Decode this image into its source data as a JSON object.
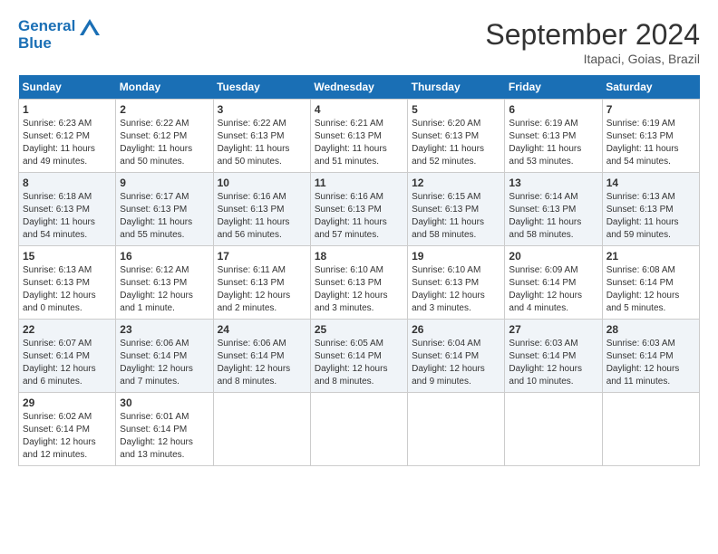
{
  "header": {
    "logo_line1": "General",
    "logo_line2": "Blue",
    "month_title": "September 2024",
    "location": "Itapaci, Goias, Brazil"
  },
  "days_of_week": [
    "Sunday",
    "Monday",
    "Tuesday",
    "Wednesday",
    "Thursday",
    "Friday",
    "Saturday"
  ],
  "weeks": [
    [
      {
        "day": "1",
        "sunrise": "6:23 AM",
        "sunset": "6:12 PM",
        "daylight": "11 hours and 49 minutes."
      },
      {
        "day": "2",
        "sunrise": "6:22 AM",
        "sunset": "6:12 PM",
        "daylight": "11 hours and 50 minutes."
      },
      {
        "day": "3",
        "sunrise": "6:22 AM",
        "sunset": "6:13 PM",
        "daylight": "11 hours and 50 minutes."
      },
      {
        "day": "4",
        "sunrise": "6:21 AM",
        "sunset": "6:13 PM",
        "daylight": "11 hours and 51 minutes."
      },
      {
        "day": "5",
        "sunrise": "6:20 AM",
        "sunset": "6:13 PM",
        "daylight": "11 hours and 52 minutes."
      },
      {
        "day": "6",
        "sunrise": "6:19 AM",
        "sunset": "6:13 PM",
        "daylight": "11 hours and 53 minutes."
      },
      {
        "day": "7",
        "sunrise": "6:19 AM",
        "sunset": "6:13 PM",
        "daylight": "11 hours and 54 minutes."
      }
    ],
    [
      {
        "day": "8",
        "sunrise": "6:18 AM",
        "sunset": "6:13 PM",
        "daylight": "11 hours and 54 minutes."
      },
      {
        "day": "9",
        "sunrise": "6:17 AM",
        "sunset": "6:13 PM",
        "daylight": "11 hours and 55 minutes."
      },
      {
        "day": "10",
        "sunrise": "6:16 AM",
        "sunset": "6:13 PM",
        "daylight": "11 hours and 56 minutes."
      },
      {
        "day": "11",
        "sunrise": "6:16 AM",
        "sunset": "6:13 PM",
        "daylight": "11 hours and 57 minutes."
      },
      {
        "day": "12",
        "sunrise": "6:15 AM",
        "sunset": "6:13 PM",
        "daylight": "11 hours and 58 minutes."
      },
      {
        "day": "13",
        "sunrise": "6:14 AM",
        "sunset": "6:13 PM",
        "daylight": "11 hours and 58 minutes."
      },
      {
        "day": "14",
        "sunrise": "6:13 AM",
        "sunset": "6:13 PM",
        "daylight": "11 hours and 59 minutes."
      }
    ],
    [
      {
        "day": "15",
        "sunrise": "6:13 AM",
        "sunset": "6:13 PM",
        "daylight": "12 hours and 0 minutes."
      },
      {
        "day": "16",
        "sunrise": "6:12 AM",
        "sunset": "6:13 PM",
        "daylight": "12 hours and 1 minute."
      },
      {
        "day": "17",
        "sunrise": "6:11 AM",
        "sunset": "6:13 PM",
        "daylight": "12 hours and 2 minutes."
      },
      {
        "day": "18",
        "sunrise": "6:10 AM",
        "sunset": "6:13 PM",
        "daylight": "12 hours and 3 minutes."
      },
      {
        "day": "19",
        "sunrise": "6:10 AM",
        "sunset": "6:13 PM",
        "daylight": "12 hours and 3 minutes."
      },
      {
        "day": "20",
        "sunrise": "6:09 AM",
        "sunset": "6:14 PM",
        "daylight": "12 hours and 4 minutes."
      },
      {
        "day": "21",
        "sunrise": "6:08 AM",
        "sunset": "6:14 PM",
        "daylight": "12 hours and 5 minutes."
      }
    ],
    [
      {
        "day": "22",
        "sunrise": "6:07 AM",
        "sunset": "6:14 PM",
        "daylight": "12 hours and 6 minutes."
      },
      {
        "day": "23",
        "sunrise": "6:06 AM",
        "sunset": "6:14 PM",
        "daylight": "12 hours and 7 minutes."
      },
      {
        "day": "24",
        "sunrise": "6:06 AM",
        "sunset": "6:14 PM",
        "daylight": "12 hours and 8 minutes."
      },
      {
        "day": "25",
        "sunrise": "6:05 AM",
        "sunset": "6:14 PM",
        "daylight": "12 hours and 8 minutes."
      },
      {
        "day": "26",
        "sunrise": "6:04 AM",
        "sunset": "6:14 PM",
        "daylight": "12 hours and 9 minutes."
      },
      {
        "day": "27",
        "sunrise": "6:03 AM",
        "sunset": "6:14 PM",
        "daylight": "12 hours and 10 minutes."
      },
      {
        "day": "28",
        "sunrise": "6:03 AM",
        "sunset": "6:14 PM",
        "daylight": "12 hours and 11 minutes."
      }
    ],
    [
      {
        "day": "29",
        "sunrise": "6:02 AM",
        "sunset": "6:14 PM",
        "daylight": "12 hours and 12 minutes."
      },
      {
        "day": "30",
        "sunrise": "6:01 AM",
        "sunset": "6:14 PM",
        "daylight": "12 hours and 13 minutes."
      },
      null,
      null,
      null,
      null,
      null
    ]
  ]
}
